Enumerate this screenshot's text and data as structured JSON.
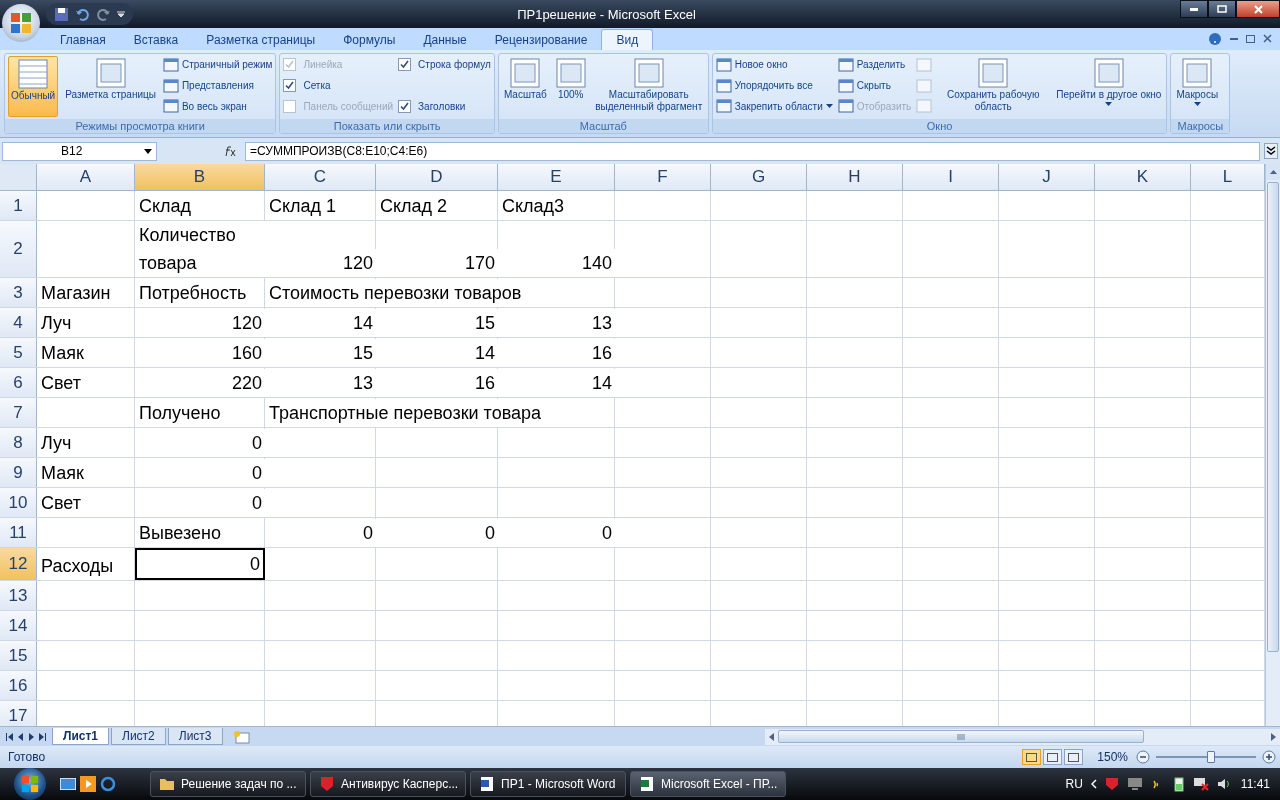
{
  "window": {
    "title": "ПР1решение - Microsoft Excel"
  },
  "ribbon_tabs": [
    {
      "label": "Главная",
      "selected": false
    },
    {
      "label": "Вставка",
      "selected": false
    },
    {
      "label": "Разметка страницы",
      "selected": false
    },
    {
      "label": "Формулы",
      "selected": false
    },
    {
      "label": "Данные",
      "selected": false
    },
    {
      "label": "Рецензирование",
      "selected": false
    },
    {
      "label": "Вид",
      "selected": true
    }
  ],
  "ribbon_groups": [
    {
      "title": "Режимы просмотра книги",
      "items": [
        {
          "kind": "large",
          "label": "Обычный",
          "selected": true
        },
        {
          "kind": "large",
          "label": "Разметка страницы",
          "selected": false
        },
        {
          "kind": "small",
          "label": "Страничный режим",
          "disabled": false
        },
        {
          "kind": "small",
          "label": "Представления",
          "disabled": false
        },
        {
          "kind": "small",
          "label": "Во весь экран",
          "disabled": false
        }
      ]
    },
    {
      "title": "Показать или скрыть",
      "items": [
        {
          "kind": "checkbox",
          "label": "Линейка",
          "checked": true,
          "disabled": true
        },
        {
          "kind": "checkbox",
          "label": "Сетка",
          "checked": true,
          "disabled": false
        },
        {
          "kind": "checkbox",
          "label": "Панель сообщений",
          "checked": false,
          "disabled": true
        },
        {
          "kind": "checkbox",
          "label": "Строка формул",
          "checked": true,
          "disabled": false
        },
        {
          "kind": "checkbox",
          "label": "Заголовки",
          "checked": true,
          "disabled": false
        }
      ]
    },
    {
      "title": "Масштаб",
      "items": [
        {
          "kind": "large",
          "label": "Масштаб",
          "selected": false
        },
        {
          "kind": "large",
          "label": "100%",
          "selected": false
        },
        {
          "kind": "large",
          "label": "Масштабировать выделенный фрагмент",
          "selected": false
        }
      ]
    },
    {
      "title": "Окно",
      "items": [
        {
          "kind": "small",
          "label": "Новое окно",
          "disabled": false
        },
        {
          "kind": "small",
          "label": "Упорядочить все",
          "disabled": false
        },
        {
          "kind": "small",
          "label": "Закрепить области",
          "disabled": false,
          "dropdown": true
        },
        {
          "kind": "small",
          "label": "Разделить",
          "disabled": false
        },
        {
          "kind": "small",
          "label": "Скрыть",
          "disabled": false
        },
        {
          "kind": "small",
          "label": "Отобразить",
          "disabled": true
        },
        {
          "kind": "icon",
          "disabled": true
        },
        {
          "kind": "icon",
          "disabled": true
        },
        {
          "kind": "icon",
          "disabled": true
        },
        {
          "kind": "large",
          "label": "Сохранить рабочую область",
          "selected": false
        },
        {
          "kind": "large",
          "label": "Перейти в другое окно",
          "selected": false,
          "dropdown": true
        }
      ]
    },
    {
      "title": "Макросы",
      "items": [
        {
          "kind": "large",
          "label": "Макросы",
          "selected": false,
          "dropdown": true
        }
      ]
    }
  ],
  "formula_bar": {
    "name_box": "B12",
    "formula": "=СУММПРОИЗВ(C8:E10;C4:E6)"
  },
  "columns": [
    {
      "label": "A",
      "selected": false
    },
    {
      "label": "B",
      "selected": true
    },
    {
      "label": "C",
      "selected": false
    },
    {
      "label": "D",
      "selected": false
    },
    {
      "label": "E",
      "selected": false
    },
    {
      "label": "F",
      "selected": false
    },
    {
      "label": "G",
      "selected": false
    },
    {
      "label": "H",
      "selected": false
    },
    {
      "label": "I",
      "selected": false
    },
    {
      "label": "J",
      "selected": false
    },
    {
      "label": "K",
      "selected": false
    },
    {
      "label": "L",
      "selected": false
    }
  ],
  "rows": [
    {
      "header": "1",
      "selected": false,
      "cells": [
        null,
        {
          "text": "Склад",
          "kind": "text",
          "selected": false
        },
        {
          "text": "Склад 1",
          "kind": "text",
          "selected": false
        },
        {
          "text": "Склад 2",
          "kind": "text",
          "selected": false
        },
        {
          "text": "Склад3",
          "kind": "text",
          "selected": false
        },
        null,
        null,
        null,
        null,
        null,
        null,
        null
      ]
    },
    {
      "header": "2",
      "selected": false,
      "cells": [
        null,
        {
          "text": "Количество товара",
          "kind": "wrap",
          "selected": false
        },
        {
          "text": "120",
          "kind": "number",
          "selected": false
        },
        {
          "text": "170",
          "kind": "number",
          "selected": false
        },
        {
          "text": "140",
          "kind": "number",
          "selected": false
        },
        null,
        null,
        null,
        null,
        null,
        null,
        null
      ]
    },
    {
      "header": "3",
      "selected": false,
      "cells": [
        {
          "text": "Магазин",
          "kind": "text",
          "selected": false
        },
        {
          "text": "Потребность",
          "kind": "text",
          "selected": false
        },
        {
          "text": "Стоимость перевозки товаров",
          "kind": "text",
          "selected": false
        },
        null,
        null,
        null,
        null,
        null,
        null,
        null,
        null,
        null
      ]
    },
    {
      "header": "4",
      "selected": false,
      "cells": [
        {
          "text": "Луч",
          "kind": "text",
          "selected": false
        },
        {
          "text": "120",
          "kind": "number",
          "selected": false
        },
        {
          "text": "14",
          "kind": "number",
          "selected": false
        },
        {
          "text": "15",
          "kind": "number",
          "selected": false
        },
        {
          "text": "13",
          "kind": "number",
          "selected": false
        },
        null,
        null,
        null,
        null,
        null,
        null,
        null
      ]
    },
    {
      "header": "5",
      "selected": false,
      "cells": [
        {
          "text": "Маяк",
          "kind": "text",
          "selected": false
        },
        {
          "text": "160",
          "kind": "number",
          "selected": false
        },
        {
          "text": "15",
          "kind": "number",
          "selected": false
        },
        {
          "text": "14",
          "kind": "number",
          "selected": false
        },
        {
          "text": "16",
          "kind": "number",
          "selected": false
        },
        null,
        null,
        null,
        null,
        null,
        null,
        null
      ]
    },
    {
      "header": "6",
      "selected": false,
      "cells": [
        {
          "text": "Свет",
          "kind": "text",
          "selected": false
        },
        {
          "text": "220",
          "kind": "number",
          "selected": false
        },
        {
          "text": "13",
          "kind": "number",
          "selected": false
        },
        {
          "text": "16",
          "kind": "number",
          "selected": false
        },
        {
          "text": "14",
          "kind": "number",
          "selected": false
        },
        null,
        null,
        null,
        null,
        null,
        null,
        null
      ]
    },
    {
      "header": "7",
      "selected": false,
      "cells": [
        null,
        {
          "text": "Получено",
          "kind": "text",
          "selected": false
        },
        {
          "text": "Транспортные перевозки товара",
          "kind": "text",
          "selected": false
        },
        null,
        null,
        null,
        null,
        null,
        null,
        null,
        null,
        null
      ]
    },
    {
      "header": "8",
      "selected": false,
      "cells": [
        {
          "text": "Луч",
          "kind": "text",
          "selected": false
        },
        {
          "text": "0",
          "kind": "number",
          "selected": false
        },
        null,
        null,
        null,
        null,
        null,
        null,
        null,
        null,
        null,
        null
      ]
    },
    {
      "header": "9",
      "selected": false,
      "cells": [
        {
          "text": "Маяк",
          "kind": "text",
          "selected": false
        },
        {
          "text": "0",
          "kind": "number",
          "selected": false
        },
        null,
        null,
        null,
        null,
        null,
        null,
        null,
        null,
        null,
        null
      ]
    },
    {
      "header": "10",
      "selected": false,
      "cells": [
        {
          "text": "Свет",
          "kind": "text",
          "selected": false
        },
        {
          "text": "0",
          "kind": "number",
          "selected": false
        },
        null,
        null,
        null,
        null,
        null,
        null,
        null,
        null,
        null,
        null
      ]
    },
    {
      "header": "11",
      "selected": false,
      "cells": [
        null,
        {
          "text": "Вывезено",
          "kind": "text",
          "selected": false
        },
        {
          "text": "0",
          "kind": "number",
          "selected": false
        },
        {
          "text": "0",
          "kind": "number",
          "selected": false
        },
        {
          "text": "0",
          "kind": "number",
          "selected": false
        },
        null,
        null,
        null,
        null,
        null,
        null,
        null
      ]
    },
    {
      "header": "12",
      "selected": true,
      "cells": [
        {
          "text": "Расходы",
          "kind": "text",
          "selected": false
        },
        {
          "text": "0",
          "kind": "number",
          "selected": true
        },
        null,
        null,
        null,
        null,
        null,
        null,
        null,
        null,
        null,
        null
      ]
    },
    {
      "header": "13",
      "selected": false,
      "cells": [
        null,
        null,
        null,
        null,
        null,
        null,
        null,
        null,
        null,
        null,
        null,
        null
      ]
    },
    {
      "header": "14",
      "selected": false,
      "cells": [
        null,
        null,
        null,
        null,
        null,
        null,
        null,
        null,
        null,
        null,
        null,
        null
      ]
    },
    {
      "header": "15",
      "selected": false,
      "cells": [
        null,
        null,
        null,
        null,
        null,
        null,
        null,
        null,
        null,
        null,
        null,
        null
      ]
    },
    {
      "header": "16",
      "selected": false,
      "cells": [
        null,
        null,
        null,
        null,
        null,
        null,
        null,
        null,
        null,
        null,
        null,
        null
      ]
    },
    {
      "header": "17",
      "selected": false,
      "cells": [
        null,
        null,
        null,
        null,
        null,
        null,
        null,
        null,
        null,
        null,
        null,
        null
      ]
    }
  ],
  "sheet_tabs": [
    {
      "label": "Лист1",
      "selected": true
    },
    {
      "label": "Лист2",
      "selected": false
    },
    {
      "label": "Лист3",
      "selected": false
    }
  ],
  "status_bar": {
    "status": "Готово",
    "views": [
      {
        "selected": true
      },
      {
        "selected": false
      },
      {
        "selected": false
      }
    ],
    "zoom": "150%",
    "zoom_slider": {
      "level": 0.55
    }
  },
  "taskbar": {
    "tasks": [
      {
        "label": "Решение задач по ...",
        "kind": "folder",
        "selected": false
      },
      {
        "label": "Антивирус Касперс...",
        "kind": "antivirus",
        "selected": false
      },
      {
        "label": "ПР1 - Microsoft Word",
        "kind": "word",
        "selected": false
      },
      {
        "label": "Microsoft Excel - ПР...",
        "kind": "excel",
        "selected": true
      }
    ],
    "language": "RU",
    "clock": "11:41"
  }
}
